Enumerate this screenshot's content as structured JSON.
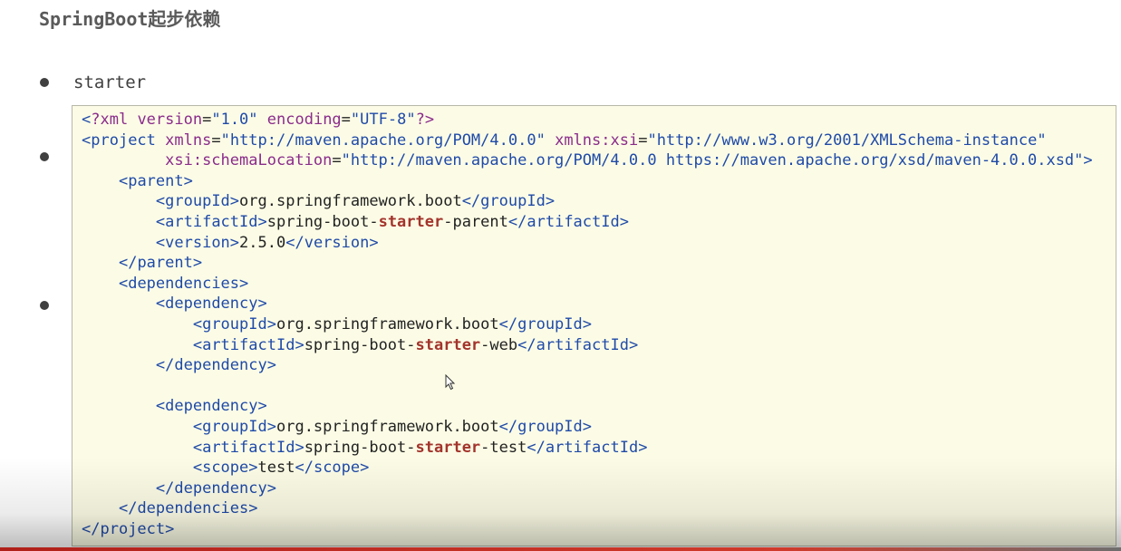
{
  "slide": {
    "title": "SpringBoot起步依赖",
    "bullets": [
      "starter"
    ]
  },
  "code": {
    "language": "xml",
    "lines": [
      [
        {
          "t": "<",
          "c": "tag"
        },
        {
          "t": "?xml ",
          "c": "attr"
        },
        {
          "t": "version",
          "c": "attr"
        },
        {
          "t": "=",
          "c": "txt"
        },
        {
          "t": "\"1.0\"",
          "c": "val"
        },
        {
          "t": " ",
          "c": "txt"
        },
        {
          "t": "encoding",
          "c": "attr"
        },
        {
          "t": "=",
          "c": "txt"
        },
        {
          "t": "\"UTF-8\"",
          "c": "val"
        },
        {
          "t": "?>",
          "c": "attr"
        }
      ],
      [
        {
          "t": "<",
          "c": "tag"
        },
        {
          "t": "project",
          "c": "tag"
        },
        {
          "t": " ",
          "c": "txt"
        },
        {
          "t": "xmlns",
          "c": "attr"
        },
        {
          "t": "=",
          "c": "txt"
        },
        {
          "t": "\"http://maven.apache.org/POM/4.0.0\"",
          "c": "val"
        },
        {
          "t": " ",
          "c": "txt"
        },
        {
          "t": "xmlns:xsi",
          "c": "attr"
        },
        {
          "t": "=",
          "c": "txt"
        },
        {
          "t": "\"http://www.w3.org/2001/XMLSchema-instance\"",
          "c": "val"
        }
      ],
      [
        {
          "t": "         ",
          "c": "txt"
        },
        {
          "t": "xsi:schemaLocation",
          "c": "attr"
        },
        {
          "t": "=",
          "c": "txt"
        },
        {
          "t": "\"http://maven.apache.org/POM/4.0.0 https://maven.apache.org/xsd/maven-4.0.0.xsd\"",
          "c": "val"
        },
        {
          "t": ">",
          "c": "tag"
        }
      ],
      [
        {
          "t": "    ",
          "c": "txt"
        },
        {
          "t": "<",
          "c": "tag"
        },
        {
          "t": "parent",
          "c": "tag"
        },
        {
          "t": ">",
          "c": "tag"
        }
      ],
      [
        {
          "t": "        ",
          "c": "txt"
        },
        {
          "t": "<",
          "c": "tag"
        },
        {
          "t": "groupId",
          "c": "tag"
        },
        {
          "t": ">",
          "c": "tag"
        },
        {
          "t": "org.springframework.boot",
          "c": "txt"
        },
        {
          "t": "</",
          "c": "tag"
        },
        {
          "t": "groupId",
          "c": "tag"
        },
        {
          "t": ">",
          "c": "tag"
        }
      ],
      [
        {
          "t": "        ",
          "c": "txt"
        },
        {
          "t": "<",
          "c": "tag"
        },
        {
          "t": "artifactId",
          "c": "tag"
        },
        {
          "t": ">",
          "c": "tag"
        },
        {
          "t": "spring-boot-",
          "c": "txt"
        },
        {
          "t": "starter",
          "c": "hl"
        },
        {
          "t": "-parent",
          "c": "txt"
        },
        {
          "t": "</",
          "c": "tag"
        },
        {
          "t": "artifactId",
          "c": "tag"
        },
        {
          "t": ">",
          "c": "tag"
        }
      ],
      [
        {
          "t": "        ",
          "c": "txt"
        },
        {
          "t": "<",
          "c": "tag"
        },
        {
          "t": "version",
          "c": "tag"
        },
        {
          "t": ">",
          "c": "tag"
        },
        {
          "t": "2.5.0",
          "c": "txt"
        },
        {
          "t": "</",
          "c": "tag"
        },
        {
          "t": "version",
          "c": "tag"
        },
        {
          "t": ">",
          "c": "tag"
        }
      ],
      [
        {
          "t": "    ",
          "c": "txt"
        },
        {
          "t": "</",
          "c": "tag"
        },
        {
          "t": "parent",
          "c": "tag"
        },
        {
          "t": ">",
          "c": "tag"
        }
      ],
      [
        {
          "t": "    ",
          "c": "txt"
        },
        {
          "t": "<",
          "c": "tag"
        },
        {
          "t": "dependencies",
          "c": "tag"
        },
        {
          "t": ">",
          "c": "tag"
        }
      ],
      [
        {
          "t": "        ",
          "c": "txt"
        },
        {
          "t": "<",
          "c": "tag"
        },
        {
          "t": "dependency",
          "c": "tag"
        },
        {
          "t": ">",
          "c": "tag"
        }
      ],
      [
        {
          "t": "            ",
          "c": "txt"
        },
        {
          "t": "<",
          "c": "tag"
        },
        {
          "t": "groupId",
          "c": "tag"
        },
        {
          "t": ">",
          "c": "tag"
        },
        {
          "t": "org.springframework.boot",
          "c": "txt"
        },
        {
          "t": "</",
          "c": "tag"
        },
        {
          "t": "groupId",
          "c": "tag"
        },
        {
          "t": ">",
          "c": "tag"
        }
      ],
      [
        {
          "t": "            ",
          "c": "txt"
        },
        {
          "t": "<",
          "c": "tag"
        },
        {
          "t": "artifactId",
          "c": "tag"
        },
        {
          "t": ">",
          "c": "tag"
        },
        {
          "t": "spring-boot-",
          "c": "txt"
        },
        {
          "t": "starter",
          "c": "hl"
        },
        {
          "t": "-web",
          "c": "txt"
        },
        {
          "t": "</",
          "c": "tag"
        },
        {
          "t": "artifactId",
          "c": "tag"
        },
        {
          "t": ">",
          "c": "tag"
        }
      ],
      [
        {
          "t": "        ",
          "c": "txt"
        },
        {
          "t": "</",
          "c": "tag"
        },
        {
          "t": "dependency",
          "c": "tag"
        },
        {
          "t": ">",
          "c": "tag"
        }
      ],
      [
        {
          "t": "",
          "c": "txt"
        }
      ],
      [
        {
          "t": "        ",
          "c": "txt"
        },
        {
          "t": "<",
          "c": "tag"
        },
        {
          "t": "dependency",
          "c": "tag"
        },
        {
          "t": ">",
          "c": "tag"
        }
      ],
      [
        {
          "t": "            ",
          "c": "txt"
        },
        {
          "t": "<",
          "c": "tag"
        },
        {
          "t": "groupId",
          "c": "tag"
        },
        {
          "t": ">",
          "c": "tag"
        },
        {
          "t": "org.springframework.boot",
          "c": "txt"
        },
        {
          "t": "</",
          "c": "tag"
        },
        {
          "t": "groupId",
          "c": "tag"
        },
        {
          "t": ">",
          "c": "tag"
        }
      ],
      [
        {
          "t": "            ",
          "c": "txt"
        },
        {
          "t": "<",
          "c": "tag"
        },
        {
          "t": "artifactId",
          "c": "tag"
        },
        {
          "t": ">",
          "c": "tag"
        },
        {
          "t": "spring-boot-",
          "c": "txt"
        },
        {
          "t": "starter",
          "c": "hl"
        },
        {
          "t": "-test",
          "c": "txt"
        },
        {
          "t": "</",
          "c": "tag"
        },
        {
          "t": "artifactId",
          "c": "tag"
        },
        {
          "t": ">",
          "c": "tag"
        }
      ],
      [
        {
          "t": "            ",
          "c": "txt"
        },
        {
          "t": "<",
          "c": "tag"
        },
        {
          "t": "scope",
          "c": "tag"
        },
        {
          "t": ">",
          "c": "tag"
        },
        {
          "t": "test",
          "c": "txt"
        },
        {
          "t": "</",
          "c": "tag"
        },
        {
          "t": "scope",
          "c": "tag"
        },
        {
          "t": ">",
          "c": "tag"
        }
      ],
      [
        {
          "t": "        ",
          "c": "txt"
        },
        {
          "t": "</",
          "c": "tag"
        },
        {
          "t": "dependency",
          "c": "tag"
        },
        {
          "t": ">",
          "c": "tag"
        }
      ],
      [
        {
          "t": "    ",
          "c": "txt"
        },
        {
          "t": "</",
          "c": "tag"
        },
        {
          "t": "dependencies",
          "c": "tag"
        },
        {
          "t": ">",
          "c": "tag"
        }
      ],
      [
        {
          "t": "</",
          "c": "tag"
        },
        {
          "t": "project",
          "c": "tag"
        },
        {
          "t": ">",
          "c": "tag"
        }
      ]
    ]
  },
  "colors": {
    "tag": "#1f4aa8",
    "attribute": "#8b2c8b",
    "highlight": "#a3342c",
    "code_background": "#fcfce6"
  },
  "icons": [
    "bullet-dot-icon",
    "mouse-cursor-icon"
  ]
}
